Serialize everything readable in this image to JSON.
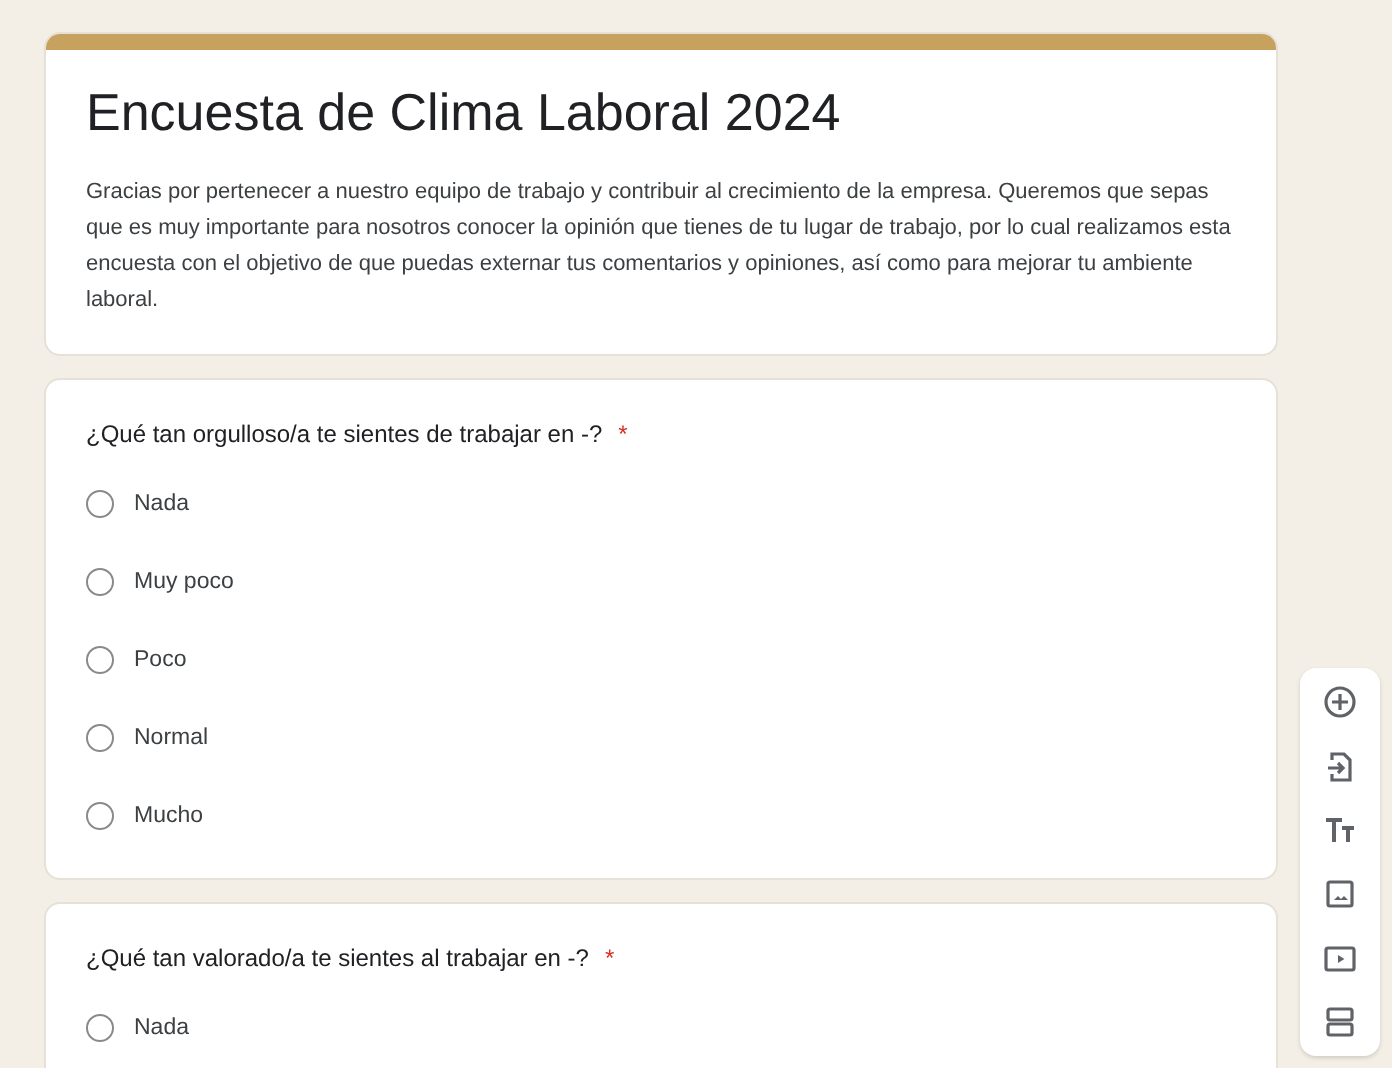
{
  "form": {
    "title": "Encuesta de Clima Laboral 2024",
    "description": "Gracias por pertenecer a nuestro equipo de trabajo y contribuir al crecimiento de la empresa. Queremos que sepas que es muy importante para nosotros conocer la opinión que tienes de tu lugar de trabajo, por lo cual realizamos esta encuesta con el objetivo de que puedas externar tus comentarios y opiniones, así como para mejorar tu ambiente laboral."
  },
  "questions": [
    {
      "text": "¿Qué tan orgulloso/a te sientes de trabajar en -?",
      "required_mark": "*",
      "options": [
        {
          "label": "Nada",
          "selected": false
        },
        {
          "label": "Muy poco",
          "selected": false
        },
        {
          "label": "Poco",
          "selected": false
        },
        {
          "label": "Normal",
          "selected": false
        },
        {
          "label": "Mucho",
          "selected": false
        }
      ]
    },
    {
      "text": "¿Qué tan valorado/a te sientes al trabajar en -?",
      "required_mark": "*",
      "options": [
        {
          "label": "Nada",
          "selected": false
        }
      ]
    }
  ],
  "toolbar": [
    {
      "kind": "add"
    },
    {
      "kind": "import"
    },
    {
      "kind": "title"
    },
    {
      "kind": "image"
    },
    {
      "kind": "video"
    },
    {
      "kind": "section"
    }
  ]
}
